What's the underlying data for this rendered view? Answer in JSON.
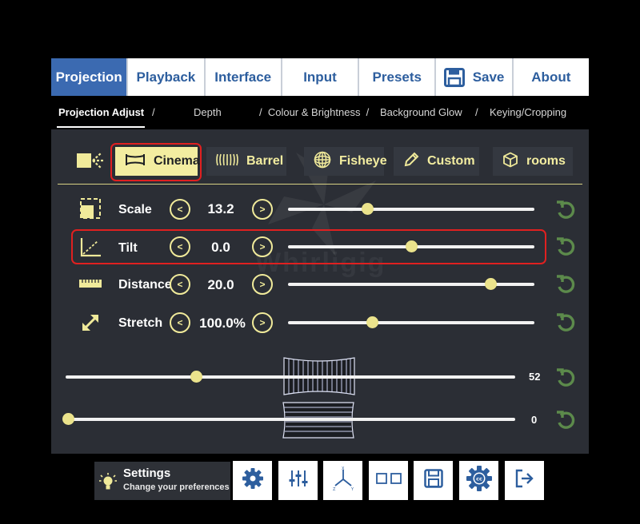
{
  "tabs": [
    {
      "label": "Projection",
      "active": true
    },
    {
      "label": "Playback",
      "active": false
    },
    {
      "label": "Interface",
      "active": false
    },
    {
      "label": "Input",
      "active": false
    },
    {
      "label": "Presets",
      "active": false
    },
    {
      "label": "Save",
      "active": false,
      "icon": "floppy-disk-icon"
    },
    {
      "label": "About",
      "active": false
    }
  ],
  "subnav": {
    "current": "Projection Adjust",
    "sep1": "/",
    "depth": "Depth",
    "colour": "/  Colour & Brightness  /",
    "glow": "Background Glow",
    "sep4": "/",
    "keying": "Keying/Cropping"
  },
  "watermark": "Whirligig",
  "modes": [
    {
      "label": "Cinema",
      "icon": "cinema-screen-icon",
      "active": true
    },
    {
      "label": "Barrel",
      "icon": "barrel-icon",
      "active": false
    },
    {
      "label": "Fisheye",
      "icon": "fisheye-icon",
      "active": false
    },
    {
      "label": "Custom",
      "icon": "pencil-icon",
      "active": false
    },
    {
      "label": "rooms",
      "icon": "cube-icon",
      "active": false
    }
  ],
  "sliders": [
    {
      "label": "Scale",
      "value": "13.2",
      "fraction": 0.32,
      "icon": "scale-icon"
    },
    {
      "label": "Tilt",
      "value": "0.0",
      "fraction": 0.5,
      "icon": "tilt-angle-icon"
    },
    {
      "label": "Distance",
      "value": "20.0",
      "fraction": 0.82,
      "icon": "ruler-icon"
    },
    {
      "label": "Stretch",
      "value": "100.0%",
      "fraction": 0.34,
      "icon": "diagonal-arrow-icon"
    }
  ],
  "curve_sliders": [
    {
      "value": "52",
      "fraction": 0.29
    },
    {
      "value": "0",
      "fraction": 0.0
    }
  ],
  "settings": {
    "title": "Settings",
    "subtitle": "Change your preferences"
  },
  "bottom_buttons": [
    "gear-icon",
    "equalizer-icon",
    "axes-xyz-icon",
    "dual-screen-icon",
    "floppy-disk-icon",
    "cc-gear-icon",
    "exit-icon"
  ],
  "colors": {
    "accent": "#f0ea9a",
    "tab_active": "#3b6ab1",
    "tab_text": "#2d5e9e",
    "panel": "#2b2e35",
    "reset": "#5c8a4b",
    "highlight": "#e02020"
  }
}
